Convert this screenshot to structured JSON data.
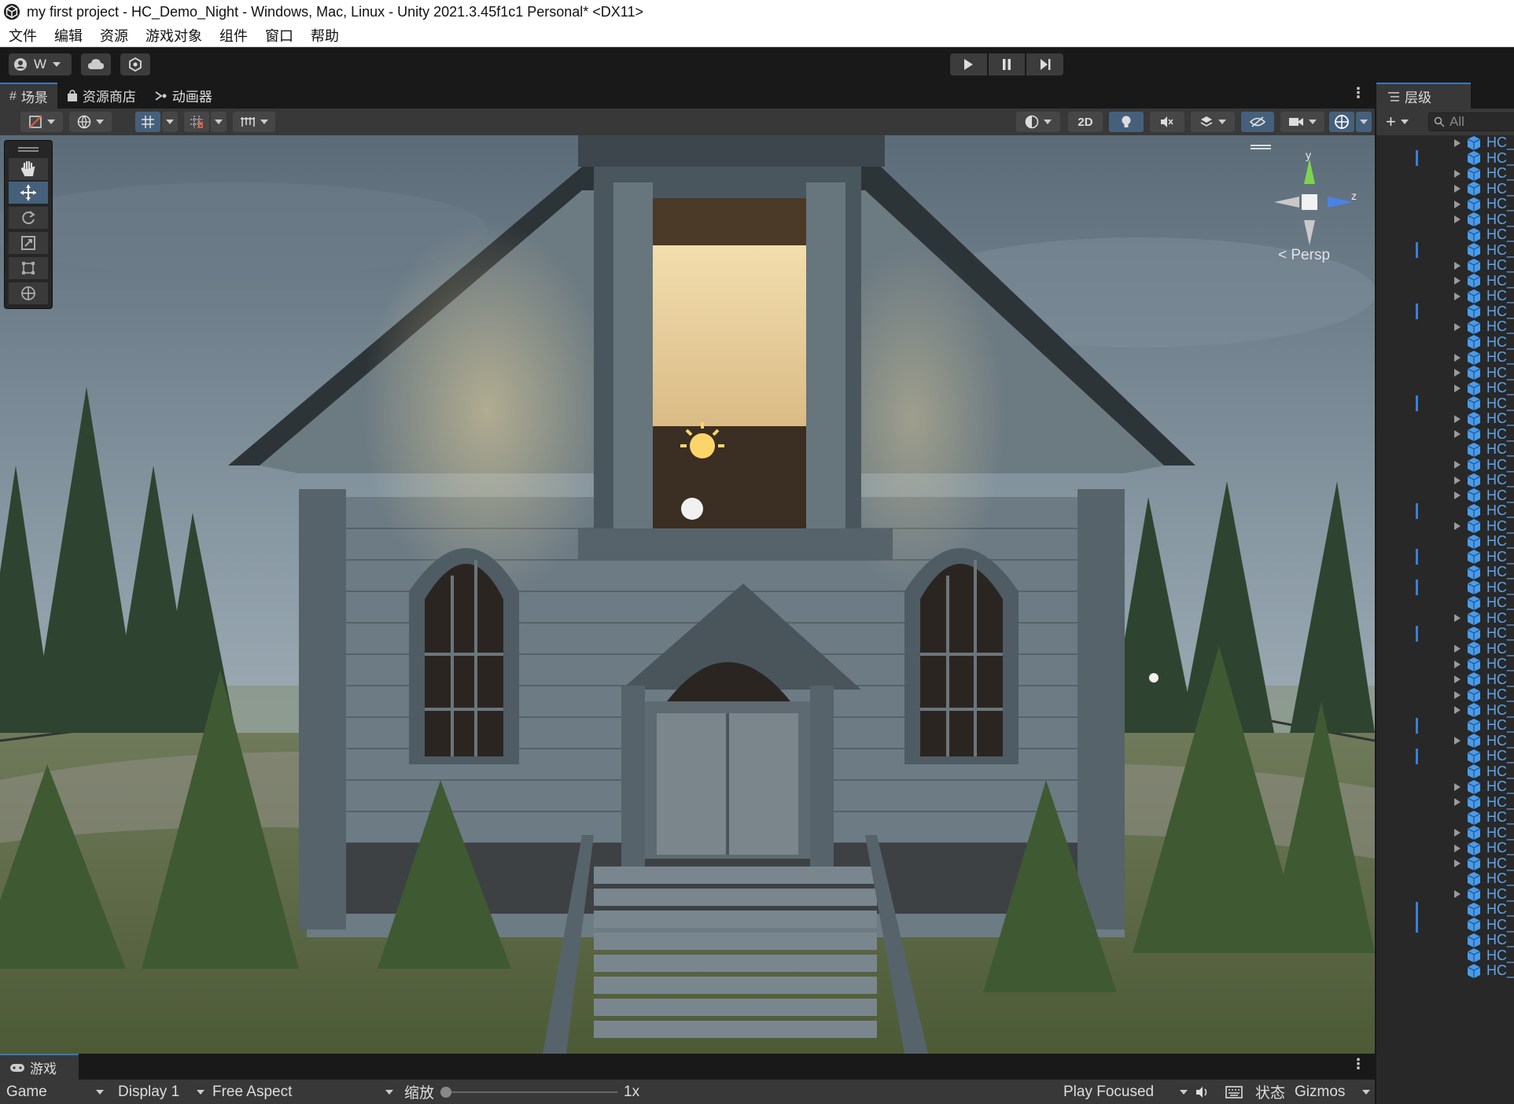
{
  "window": {
    "title": "my first project - HC_Demo_Night - Windows, Mac, Linux - Unity 2021.3.45f1c1 Personal* <DX11>"
  },
  "menu": [
    "文件",
    "编辑",
    "资源",
    "游戏对象",
    "组件",
    "窗口",
    "帮助"
  ],
  "toolbar": {
    "account_label": "W"
  },
  "scene_tabs": [
    {
      "label": "场景",
      "icon": "grid-icon",
      "active": true
    },
    {
      "label": "资源商店",
      "icon": "store-bag-icon",
      "active": false
    },
    {
      "label": "动画器",
      "icon": "animator-icon",
      "active": false
    }
  ],
  "scene_toolbar": {
    "mode_2d_label": "2D"
  },
  "gizmo": {
    "y_label": "y",
    "z_label": "z",
    "persp_label": "< Persp"
  },
  "game_panel": {
    "tab_label": "游戏",
    "view_select": "Game",
    "display_select": "Display 1",
    "aspect_select": "Free Aspect",
    "scale_label": "缩放",
    "scale_value": "1x",
    "play_mode_select": "Play Focused",
    "stats_label": "状态",
    "gizmos_label": "Gizmos"
  },
  "hierarchy": {
    "tab_label": "层级",
    "search_placeholder": "All",
    "rows": [
      {
        "label": "HC_",
        "expandable": true,
        "marked": false
      },
      {
        "label": "HC_",
        "expandable": false,
        "marked": true
      },
      {
        "label": "HC_",
        "expandable": true,
        "marked": false
      },
      {
        "label": "HC_",
        "expandable": true,
        "marked": false
      },
      {
        "label": "HC_",
        "expandable": true,
        "marked": false
      },
      {
        "label": "HC_",
        "expandable": true,
        "marked": false
      },
      {
        "label": "HC_",
        "expandable": false,
        "marked": false
      },
      {
        "label": "HC_",
        "expandable": false,
        "marked": true
      },
      {
        "label": "HC_",
        "expandable": true,
        "marked": false
      },
      {
        "label": "HC_",
        "expandable": true,
        "marked": false
      },
      {
        "label": "HC_",
        "expandable": true,
        "marked": false
      },
      {
        "label": "HC_",
        "expandable": false,
        "marked": true
      },
      {
        "label": "HC_",
        "expandable": true,
        "marked": false
      },
      {
        "label": "HC_",
        "expandable": false,
        "marked": false
      },
      {
        "label": "HC_",
        "expandable": true,
        "marked": false
      },
      {
        "label": "HC_",
        "expandable": true,
        "marked": false
      },
      {
        "label": "HC_",
        "expandable": true,
        "marked": false
      },
      {
        "label": "HC_",
        "expandable": false,
        "marked": true
      },
      {
        "label": "HC_",
        "expandable": true,
        "marked": false
      },
      {
        "label": "HC_",
        "expandable": true,
        "marked": false
      },
      {
        "label": "HC_",
        "expandable": false,
        "marked": false
      },
      {
        "label": "HC_",
        "expandable": true,
        "marked": false
      },
      {
        "label": "HC_",
        "expandable": true,
        "marked": false
      },
      {
        "label": "HC_",
        "expandable": true,
        "marked": false
      },
      {
        "label": "HC_",
        "expandable": false,
        "marked": true
      },
      {
        "label": "HC_",
        "expandable": true,
        "marked": false
      },
      {
        "label": "HC_",
        "expandable": false,
        "marked": false
      },
      {
        "label": "HC_",
        "expandable": false,
        "marked": true
      },
      {
        "label": "HC_",
        "expandable": false,
        "marked": false
      },
      {
        "label": "HC_",
        "expandable": false,
        "marked": true
      },
      {
        "label": "HC_",
        "expandable": false,
        "marked": false
      },
      {
        "label": "HC_",
        "expandable": true,
        "marked": false
      },
      {
        "label": "HC_",
        "expandable": false,
        "marked": true
      },
      {
        "label": "HC_",
        "expandable": true,
        "marked": false
      },
      {
        "label": "HC_",
        "expandable": true,
        "marked": false
      },
      {
        "label": "HC_",
        "expandable": true,
        "marked": false
      },
      {
        "label": "HC_",
        "expandable": true,
        "marked": false
      },
      {
        "label": "HC_",
        "expandable": true,
        "marked": false
      },
      {
        "label": "HC_",
        "expandable": false,
        "marked": true
      },
      {
        "label": "HC_",
        "expandable": true,
        "marked": false
      },
      {
        "label": "HC_",
        "expandable": false,
        "marked": true
      },
      {
        "label": "HC_",
        "expandable": false,
        "marked": false
      },
      {
        "label": "HC_",
        "expandable": true,
        "marked": false
      },
      {
        "label": "HC_",
        "expandable": true,
        "marked": false
      },
      {
        "label": "HC_",
        "expandable": false,
        "marked": false
      },
      {
        "label": "HC_",
        "expandable": true,
        "marked": false
      },
      {
        "label": "HC_",
        "expandable": true,
        "marked": false
      },
      {
        "label": "HC_",
        "expandable": true,
        "marked": false
      },
      {
        "label": "HC_",
        "expandable": false,
        "marked": false
      },
      {
        "label": "HC_",
        "expandable": true,
        "marked": false
      },
      {
        "label": "HC_",
        "expandable": false,
        "marked": true
      },
      {
        "label": "HC_",
        "expandable": false,
        "marked": true
      },
      {
        "label": "HC_",
        "expandable": false,
        "marked": false
      },
      {
        "label": "HC_",
        "expandable": false,
        "marked": false
      },
      {
        "label": "HC_",
        "expandable": false,
        "marked": false
      }
    ]
  },
  "colors": {
    "accent_blue": "#3a79bb",
    "hierarchy_text": "#5fa4ea",
    "panel_bg": "#383838",
    "dark_bg": "#191919"
  }
}
